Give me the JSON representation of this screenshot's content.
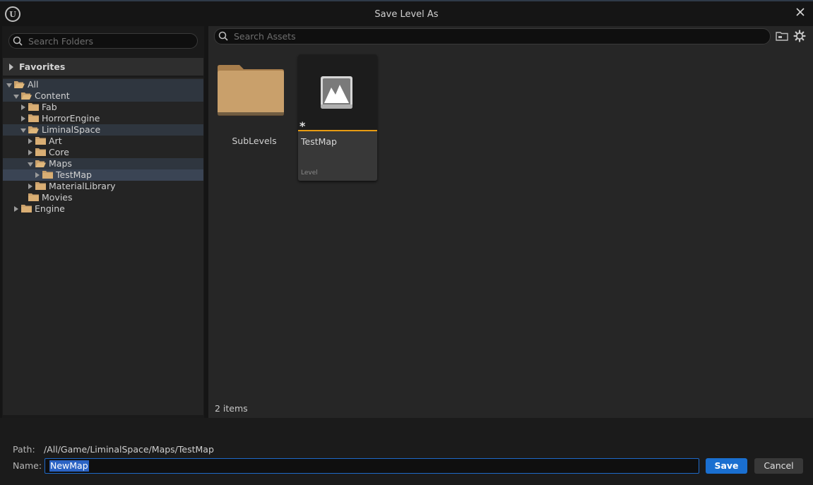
{
  "window": {
    "title": "Save Level As",
    "logo_icon": "unreal-logo-icon",
    "close_icon": "close-icon"
  },
  "left_panel": {
    "search_placeholder": "Search Folders",
    "favorites_label": "Favorites",
    "tree": [
      {
        "label": "All",
        "depth": 0,
        "expanded": true
      },
      {
        "label": "Content",
        "depth": 1,
        "expanded": true
      },
      {
        "label": "Fab",
        "depth": 2,
        "expanded": false
      },
      {
        "label": "HorrorEngine",
        "depth": 2,
        "expanded": false
      },
      {
        "label": "LiminalSpace",
        "depth": 2,
        "expanded": true
      },
      {
        "label": "Art",
        "depth": 3,
        "expanded": false
      },
      {
        "label": "Core",
        "depth": 3,
        "expanded": false
      },
      {
        "label": "Maps",
        "depth": 3,
        "expanded": true
      },
      {
        "label": "TestMap",
        "depth": 4,
        "expanded": false,
        "selected": true
      },
      {
        "label": "MaterialLibrary",
        "depth": 3,
        "expanded": false
      },
      {
        "label": "Movies",
        "depth": 3,
        "expanded": null
      },
      {
        "label": "Engine",
        "depth": 1,
        "expanded": false
      }
    ]
  },
  "right_panel": {
    "search_placeholder": "Search Assets",
    "items": [
      {
        "name": "SubLevels",
        "kind": "folder"
      },
      {
        "name": "TestMap",
        "kind": "level",
        "type_label": "Level",
        "modified_marker": "*"
      }
    ],
    "item_count": "2 items"
  },
  "footer": {
    "path_label": "Path:",
    "path_value": "/All/Game/LiminalSpace/Maps/TestMap",
    "name_label": "Name:",
    "name_value": "NewMap",
    "save_label": "Save",
    "cancel_label": "Cancel"
  },
  "colors": {
    "accent_blue": "#1a6fd0",
    "modified_orange": "#e79b12",
    "folder_tan": "#c9a06b"
  }
}
